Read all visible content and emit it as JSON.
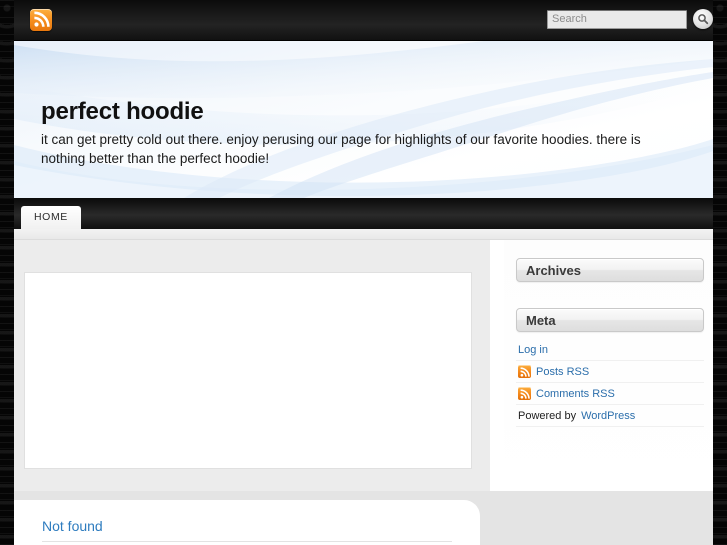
{
  "topbar": {
    "rss_icon": "rss-feed-icon",
    "search": {
      "placeholder": "Search",
      "value": "",
      "button_icon": "magnifier-icon",
      "button_label": ""
    }
  },
  "banner": {
    "site_title": "perfect hoodie",
    "tagline": "it can get pretty cold out there. enjoy perusing our page for highlights of our favorite hoodies. there is nothing better than the perfect hoodie!"
  },
  "nav": {
    "items": [
      {
        "label": "HOME",
        "active": true
      }
    ]
  },
  "sidebar": {
    "widgets": [
      {
        "title": "Archives",
        "items": []
      },
      {
        "title": "Meta",
        "items": [
          {
            "label": "Log in",
            "icon": "",
            "link": true
          },
          {
            "label": "Posts RSS",
            "icon": "rss-feed-icon",
            "link": true
          },
          {
            "label": "Comments RSS",
            "icon": "rss-feed-icon",
            "link": true
          },
          {
            "label": "Powered by",
            "suffix": "WordPress",
            "icon": "",
            "link": false
          }
        ]
      }
    ]
  },
  "main": {
    "post_box_content": "",
    "notfound": {
      "title": "Not found"
    }
  },
  "colors": {
    "accent_orange": "#f5881a",
    "link_blue": "#2b6eab",
    "heading_blue": "#2e7cbf",
    "chrome_dark": "#101010",
    "banner_light": "#eef4fb"
  }
}
